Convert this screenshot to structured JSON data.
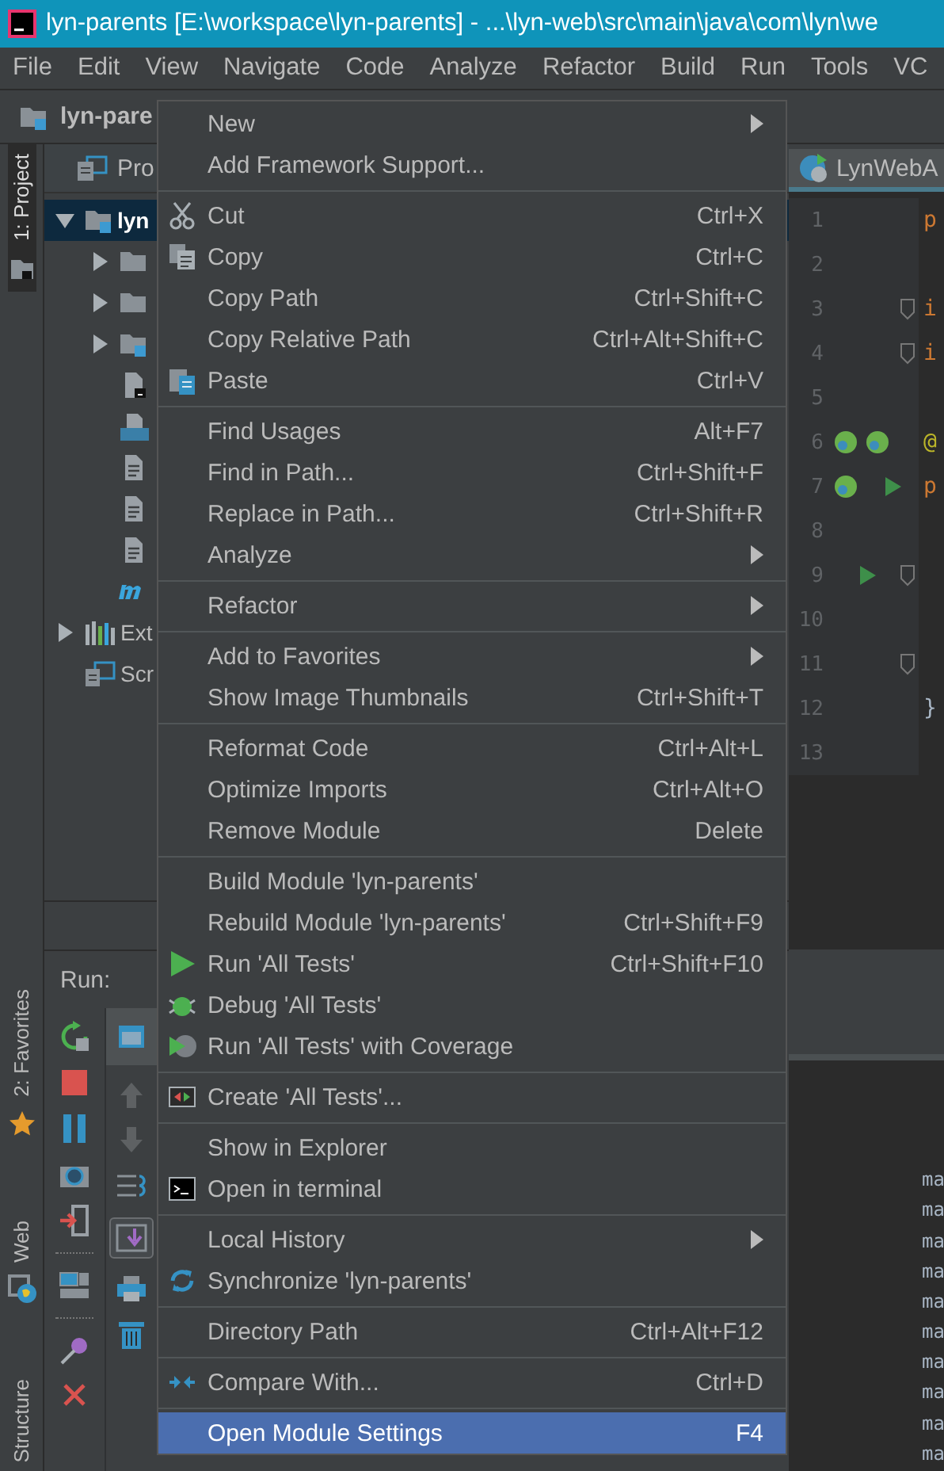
{
  "window": {
    "title": "lyn-parents [E:\\workspace\\lyn-parents] - ...\\lyn-web\\src\\main\\java\\com\\lyn\\we"
  },
  "menu_bar": [
    "File",
    "Edit",
    "View",
    "Navigate",
    "Code",
    "Analyze",
    "Refactor",
    "Build",
    "Run",
    "Tools",
    "VC"
  ],
  "navigation_bar": {
    "crumb": "lyn-pare"
  },
  "tool_window_strip": [
    {
      "label": "1: Project",
      "selected": true
    },
    {
      "label": "2: Favorites",
      "selected": false
    },
    {
      "label": "Web",
      "selected": false
    },
    {
      "label": "Structure",
      "selected": false
    }
  ],
  "project_panel": {
    "header": "Pro",
    "tree": [
      {
        "kind": "module",
        "label": "lyn",
        "expanded": true,
        "selected": true,
        "children": [
          {
            "kind": "folder",
            "expanded": false,
            "selected": false
          },
          {
            "kind": "folder",
            "expanded": false,
            "selected": false
          },
          {
            "kind": "module",
            "expanded": false,
            "selected": false
          },
          {
            "kind": "script",
            "selected": false
          },
          {
            "kind": "markdown",
            "selected": false
          },
          {
            "kind": "file",
            "selected": false
          },
          {
            "kind": "file",
            "selected": false
          },
          {
            "kind": "file",
            "selected": false
          },
          {
            "kind": "maven",
            "selected": false
          }
        ]
      },
      {
        "kind": "libraries",
        "label": "Ext",
        "expanded": false,
        "selected": false
      },
      {
        "kind": "scratches",
        "label": "Scr",
        "selected": false
      }
    ]
  },
  "editor": {
    "tab": "LynWebA",
    "lines": [
      {
        "number": "1",
        "kind": "keyword",
        "code": "p"
      },
      {
        "number": "2"
      },
      {
        "number": "3",
        "kind": "keyword",
        "code": "i"
      },
      {
        "number": "4",
        "kind": "keyword",
        "code": "i"
      },
      {
        "number": "5"
      },
      {
        "number": "6",
        "kind": "annotation",
        "code": "@"
      },
      {
        "number": "7",
        "kind": "keyword",
        "code": "p"
      },
      {
        "number": "8"
      },
      {
        "number": "9"
      },
      {
        "number": "10"
      },
      {
        "number": "11"
      },
      {
        "number": "12",
        "kind": "plain",
        "code": "}"
      },
      {
        "number": "13"
      }
    ]
  },
  "run_panel": {
    "title": "Run:",
    "console_lines": [
      "ma",
      "ma",
      "ma",
      "ma",
      "ma",
      "ma",
      "ma",
      "ma",
      "ma",
      "ma"
    ]
  },
  "context_menu": {
    "items": [
      {
        "kind": "submenu",
        "label": "New",
        "selected": false
      },
      {
        "kind": "item",
        "label": "Add Framework Support...",
        "selected": false
      },
      {
        "kind": "separator"
      },
      {
        "kind": "item",
        "label": "Cut",
        "shortcut": "Ctrl+X",
        "selected": false
      },
      {
        "kind": "item",
        "label": "Copy",
        "shortcut": "Ctrl+C",
        "selected": false
      },
      {
        "kind": "item",
        "label": "Copy Path",
        "shortcut": "Ctrl+Shift+C",
        "selected": false
      },
      {
        "kind": "item",
        "label": "Copy Relative Path",
        "shortcut": "Ctrl+Alt+Shift+C",
        "selected": false
      },
      {
        "kind": "item",
        "label": "Paste",
        "shortcut": "Ctrl+V",
        "selected": false
      },
      {
        "kind": "separator"
      },
      {
        "kind": "item",
        "label": "Find Usages",
        "shortcut": "Alt+F7",
        "selected": false
      },
      {
        "kind": "item",
        "label": "Find in Path...",
        "shortcut": "Ctrl+Shift+F",
        "selected": false
      },
      {
        "kind": "item",
        "label": "Replace in Path...",
        "shortcut": "Ctrl+Shift+R",
        "selected": false
      },
      {
        "kind": "submenu",
        "label": "Analyze",
        "selected": false
      },
      {
        "kind": "separator"
      },
      {
        "kind": "submenu",
        "label": "Refactor",
        "selected": false
      },
      {
        "kind": "separator"
      },
      {
        "kind": "submenu",
        "label": "Add to Favorites",
        "selected": false
      },
      {
        "kind": "item",
        "label": "Show Image Thumbnails",
        "shortcut": "Ctrl+Shift+T",
        "selected": false
      },
      {
        "kind": "separator"
      },
      {
        "kind": "item",
        "label": "Reformat Code",
        "shortcut": "Ctrl+Alt+L",
        "selected": false
      },
      {
        "kind": "item",
        "label": "Optimize Imports",
        "shortcut": "Ctrl+Alt+O",
        "selected": false
      },
      {
        "kind": "item",
        "label": "Remove Module",
        "shortcut": "Delete",
        "selected": false
      },
      {
        "kind": "separator"
      },
      {
        "kind": "item",
        "label": "Build Module 'lyn-parents'",
        "selected": false
      },
      {
        "kind": "item",
        "label": "Rebuild Module 'lyn-parents'",
        "shortcut": "Ctrl+Shift+F9",
        "selected": false
      },
      {
        "kind": "item",
        "label": "Run 'All Tests'",
        "shortcut": "Ctrl+Shift+F10",
        "selected": false
      },
      {
        "kind": "item",
        "label": "Debug 'All Tests'",
        "selected": false
      },
      {
        "kind": "item",
        "label": "Run 'All Tests' with Coverage",
        "selected": false
      },
      {
        "kind": "separator"
      },
      {
        "kind": "item",
        "label": "Create 'All Tests'...",
        "selected": false
      },
      {
        "kind": "separator"
      },
      {
        "kind": "item",
        "label": "Show in Explorer",
        "selected": false
      },
      {
        "kind": "item",
        "label": "Open in terminal",
        "selected": false
      },
      {
        "kind": "separator"
      },
      {
        "kind": "submenu",
        "label": "Local History",
        "selected": false
      },
      {
        "kind": "item",
        "label": "Synchronize 'lyn-parents'",
        "selected": false
      },
      {
        "kind": "separator"
      },
      {
        "kind": "item",
        "label": "Directory Path",
        "shortcut": "Ctrl+Alt+F12",
        "selected": false
      },
      {
        "kind": "separator"
      },
      {
        "kind": "item",
        "label": "Compare With...",
        "shortcut": "Ctrl+D",
        "selected": false
      },
      {
        "kind": "separator"
      },
      {
        "kind": "item",
        "label": "Open Module Settings",
        "shortcut": "F4",
        "selected": true
      }
    ]
  }
}
